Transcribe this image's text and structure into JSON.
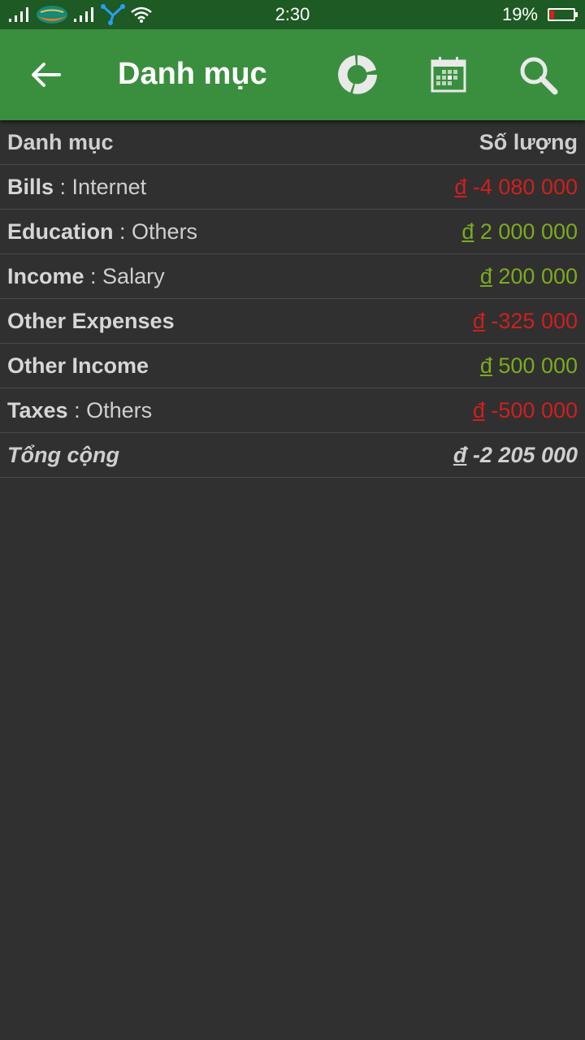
{
  "status_bar": {
    "time": "2:30",
    "battery_percent_text": "19%",
    "battery_level": 0.19,
    "icons": [
      "signal-icon",
      "carrier-logo-icon",
      "signal-icon",
      "data-share-icon",
      "wifi-icon",
      "battery-icon"
    ]
  },
  "app_bar": {
    "title": "Danh mục",
    "icons": [
      "back-arrow-icon",
      "donut-chart-icon",
      "calendar-icon",
      "search-icon"
    ],
    "color": "#3a8f3e"
  },
  "table": {
    "header": {
      "category": "Danh mục",
      "amount": "Số lượng"
    },
    "rows": [
      {
        "category": "Bills",
        "separator": " : ",
        "subcategory": "Internet",
        "currency": "đ",
        "amount": " -4 080 000",
        "sign": "negative"
      },
      {
        "category": "Education",
        "separator": " : ",
        "subcategory": "Others",
        "currency": "đ",
        "amount": " 2 000 000",
        "sign": "positive"
      },
      {
        "category": "Income",
        "separator": " : ",
        "subcategory": "Salary",
        "currency": "đ",
        "amount": " 200 000",
        "sign": "positive"
      },
      {
        "category": "Other Expenses",
        "separator": "",
        "subcategory": "",
        "currency": "đ",
        "amount": " -325 000",
        "sign": "negative"
      },
      {
        "category": "Other Income",
        "separator": "",
        "subcategory": "",
        "currency": "đ",
        "amount": " 500 000",
        "sign": "positive"
      },
      {
        "category": "Taxes",
        "separator": " : ",
        "subcategory": "Others",
        "currency": "đ",
        "amount": " -500 000",
        "sign": "negative"
      }
    ],
    "total": {
      "label": "Tổng cộng",
      "currency": "đ",
      "amount": " -2 205 000"
    }
  },
  "colors": {
    "negative": "#d01f1f",
    "positive": "#7cab1f",
    "background": "#303030",
    "status_bar": "#1e5a24"
  }
}
